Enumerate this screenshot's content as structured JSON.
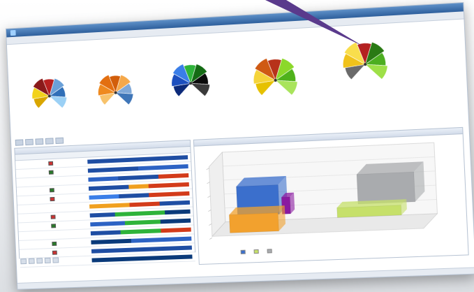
{
  "window": {
    "title": "",
    "menu": [
      "",
      "",
      "",
      "",
      "",
      "",
      ""
    ]
  },
  "gauges": [
    {
      "title": "",
      "colors": [
        "#d9a600",
        "#f2d21b",
        "#8a1a1a",
        "#b82020",
        "#6aa0d8",
        "#2f6fb8",
        "#9bd0f5"
      ]
    },
    {
      "title": "",
      "colors": [
        "#f7c26b",
        "#ef8a1f",
        "#e36f10",
        "#d25e0a",
        "#f5a84a",
        "#7fa8d8",
        "#3f76b8"
      ]
    },
    {
      "title": "",
      "colors": [
        "#0c2a7a",
        "#1c4fbf",
        "#3a7ee8",
        "#2eb33a",
        "#146b14",
        "#0a0a0a",
        "#3a3a3a"
      ]
    },
    {
      "title": "",
      "colors": [
        "#e6c100",
        "#f5d43a",
        "#cf5a14",
        "#b7321a",
        "#8cd82a",
        "#4fb21b",
        "#a9e45c"
      ]
    },
    {
      "title": "",
      "colors": [
        "#6a6a6a",
        "#f0c21a",
        "#f9de4c",
        "#b42020",
        "#2a7a14",
        "#4cae20",
        "#9ee048"
      ]
    }
  ],
  "grid": {
    "title": "",
    "columns": [
      "",
      "",
      "",
      "",
      ""
    ],
    "rows": 12,
    "bar_palette": [
      "#1f4ea3",
      "#2d63c4",
      "#3a7ee8",
      "#f0a020",
      "#d33b1a",
      "#2eb33a",
      "#0a3a7a"
    ]
  },
  "chart": {
    "title": "",
    "legend": [
      "",
      "",
      ""
    ],
    "colors": {
      "blue": "#3b6fcc",
      "orange": "#f2a12e",
      "purple": "#8a1aa0",
      "gray": "#a9abae",
      "lime": "#c6e06a"
    }
  }
}
